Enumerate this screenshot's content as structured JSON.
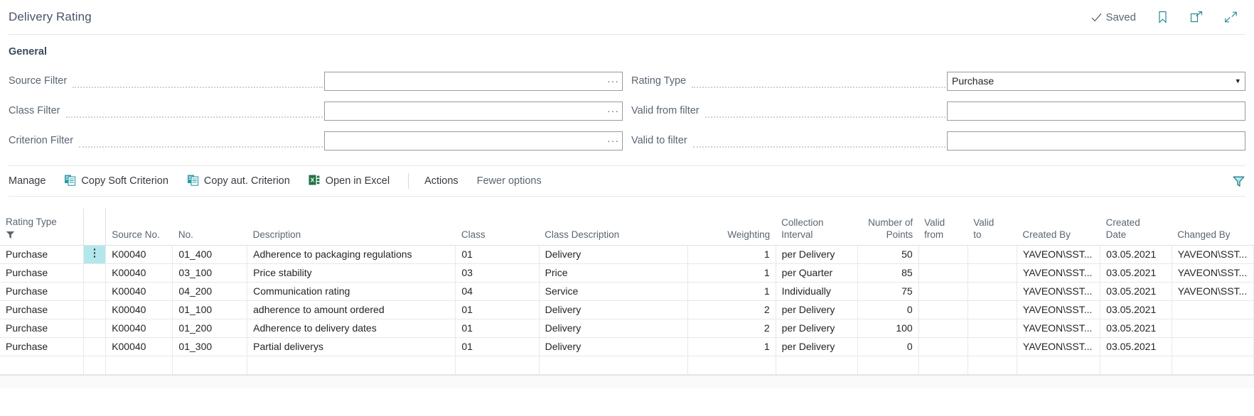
{
  "titlebar": {
    "title": "Delivery Rating",
    "saved_label": "Saved",
    "saved_icon": "check-icon",
    "bookmark_icon": "bookmark-icon",
    "open_new_window_icon": "open-in-new-window-icon",
    "collapse_icon": "collapse-icon"
  },
  "general": {
    "heading": "General",
    "fields_left": [
      {
        "label": "Source Filter",
        "value": "",
        "placeholder": "",
        "control": "lookup",
        "ellipsis": "···"
      },
      {
        "label": "Class Filter",
        "value": "",
        "placeholder": "",
        "control": "lookup",
        "ellipsis": "···"
      },
      {
        "label": "Criterion Filter",
        "value": "",
        "placeholder": "",
        "control": "lookup",
        "ellipsis": "···"
      }
    ],
    "fields_right": [
      {
        "label": "Rating Type",
        "value": "Purchase",
        "placeholder": "",
        "control": "select",
        "options": [
          "Purchase"
        ]
      },
      {
        "label": "Valid from filter",
        "value": "",
        "placeholder": "",
        "control": "text"
      },
      {
        "label": "Valid to filter",
        "value": "",
        "placeholder": "",
        "control": "text"
      }
    ]
  },
  "toolbar": {
    "items": [
      {
        "label": "Manage",
        "icon": null,
        "muted": false
      },
      {
        "label": "Copy Soft Criterion",
        "icon": "copy-icon",
        "muted": false
      },
      {
        "label": "Copy aut. Criterion",
        "icon": "copy-icon",
        "muted": false
      },
      {
        "label": "Open in Excel",
        "icon": "excel-icon",
        "muted": false
      },
      {
        "label": "Actions",
        "icon": null,
        "muted": false
      },
      {
        "label": "Fewer options",
        "icon": null,
        "muted": true
      }
    ],
    "filter_icon": "funnel-icon"
  },
  "grid": {
    "columns": [
      {
        "key": "rating_type",
        "header": [
          "Rating Type"
        ],
        "align": "left",
        "filtered": true
      },
      {
        "key": "handle",
        "header": [
          ""
        ],
        "align": "center"
      },
      {
        "key": "source_no",
        "header": [
          "Source No."
        ],
        "align": "left"
      },
      {
        "key": "no",
        "header": [
          "No."
        ],
        "align": "left"
      },
      {
        "key": "description",
        "header": [
          "Description"
        ],
        "align": "left"
      },
      {
        "key": "class",
        "header": [
          "Class"
        ],
        "align": "left"
      },
      {
        "key": "class_description",
        "header": [
          "Class Description"
        ],
        "align": "left"
      },
      {
        "key": "weighting",
        "header": [
          "Weighting"
        ],
        "align": "right"
      },
      {
        "key": "collection_interval",
        "header": [
          "Collection",
          "Interval"
        ],
        "align": "left"
      },
      {
        "key": "number_of_points",
        "header": [
          "Number of",
          "Points"
        ],
        "align": "right"
      },
      {
        "key": "valid_from",
        "header": [
          "Valid",
          "from"
        ],
        "align": "left"
      },
      {
        "key": "valid_to",
        "header": [
          "Valid",
          "to"
        ],
        "align": "left"
      },
      {
        "key": "created_by",
        "header": [
          "Created By"
        ],
        "align": "left"
      },
      {
        "key": "created_date",
        "header": [
          "Created",
          "Date"
        ],
        "align": "left"
      },
      {
        "key": "changed_by",
        "header": [
          "Changed By"
        ],
        "align": "left"
      }
    ],
    "rows": [
      {
        "rating_type": "Purchase",
        "selected": true,
        "source_no": "K00040",
        "no": "01_400",
        "description": "Adherence to packaging regulations",
        "class": "01",
        "class_description": "Delivery",
        "weighting": "1",
        "collection_interval": "per Delivery",
        "number_of_points": "50",
        "valid_from": "",
        "valid_to": "",
        "created_by": "YAVEON\\SST...",
        "created_date": "03.05.2021",
        "changed_by": "YAVEON\\SST..."
      },
      {
        "rating_type": "Purchase",
        "selected": false,
        "source_no": "K00040",
        "no": "03_100",
        "description": "Price stability",
        "class": "03",
        "class_description": "Price",
        "weighting": "1",
        "collection_interval": "per Quarter",
        "number_of_points": "85",
        "valid_from": "",
        "valid_to": "",
        "created_by": "YAVEON\\SST...",
        "created_date": "03.05.2021",
        "changed_by": "YAVEON\\SST..."
      },
      {
        "rating_type": "Purchase",
        "selected": false,
        "source_no": "K00040",
        "no": "04_200",
        "description": "Communication rating",
        "class": "04",
        "class_description": "Service",
        "weighting": "1",
        "collection_interval": "Individually",
        "number_of_points": "75",
        "valid_from": "",
        "valid_to": "",
        "created_by": "YAVEON\\SST...",
        "created_date": "03.05.2021",
        "changed_by": "YAVEON\\SST..."
      },
      {
        "rating_type": "Purchase",
        "selected": false,
        "source_no": "K00040",
        "no": "01_100",
        "description": "adherence to amount ordered",
        "class": "01",
        "class_description": "Delivery",
        "weighting": "2",
        "collection_interval": "per Delivery",
        "number_of_points": "0",
        "valid_from": "",
        "valid_to": "",
        "created_by": "YAVEON\\SST...",
        "created_date": "03.05.2021",
        "changed_by": ""
      },
      {
        "rating_type": "Purchase",
        "selected": false,
        "source_no": "K00040",
        "no": "01_200",
        "description": "Adherence to delivery dates",
        "class": "01",
        "class_description": "Delivery",
        "weighting": "2",
        "collection_interval": "per Delivery",
        "number_of_points": "100",
        "valid_from": "",
        "valid_to": "",
        "created_by": "YAVEON\\SST...",
        "created_date": "03.05.2021",
        "changed_by": ""
      },
      {
        "rating_type": "Purchase",
        "selected": false,
        "source_no": "K00040",
        "no": "01_300",
        "description": "Partial deliverys",
        "class": "01",
        "class_description": "Delivery",
        "weighting": "1",
        "collection_interval": "per Delivery",
        "number_of_points": "0",
        "valid_from": "",
        "valid_to": "",
        "created_by": "YAVEON\\SST...",
        "created_date": "03.05.2021",
        "changed_by": ""
      },
      {
        "rating_type": "",
        "selected": false,
        "source_no": "",
        "no": "",
        "description": "",
        "class": "",
        "class_description": "",
        "weighting": "",
        "collection_interval": "",
        "number_of_points": "",
        "valid_from": "",
        "valid_to": "",
        "created_by": "",
        "created_date": "",
        "changed_by": ""
      }
    ]
  },
  "colors": {
    "accent": "#2a9aa8",
    "selection": "#b3e7ec",
    "excel_green": "#217346",
    "label_gray": "#5a6572",
    "border": "#e8e8e8"
  }
}
